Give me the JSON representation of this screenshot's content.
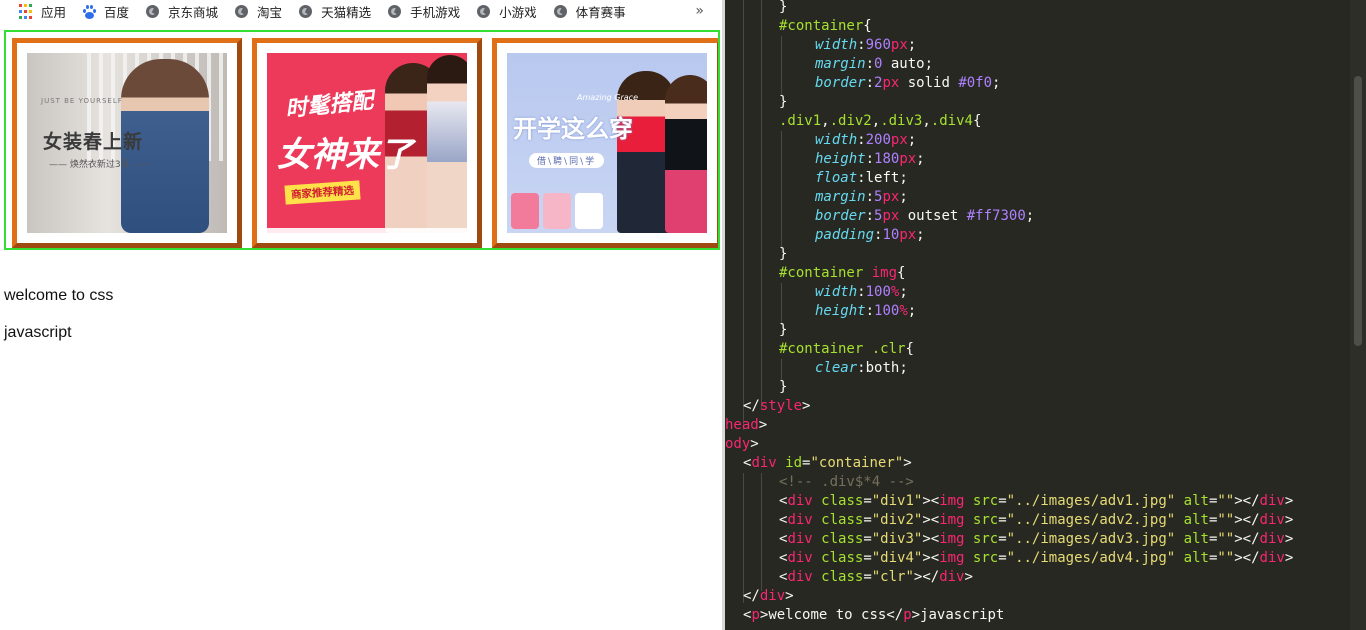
{
  "bookmarks": {
    "items": [
      {
        "label": "应用",
        "icon": "apps-grid-icon"
      },
      {
        "label": "百度",
        "icon": "baidu-paw-icon"
      },
      {
        "label": "京东商城",
        "icon": "globe-icon"
      },
      {
        "label": "淘宝",
        "icon": "globe-icon"
      },
      {
        "label": "天猫精选",
        "icon": "globe-icon"
      },
      {
        "label": "手机游戏",
        "icon": "globe-icon"
      },
      {
        "label": "小游戏",
        "icon": "globe-icon"
      },
      {
        "label": "体育赛事",
        "icon": "globe-icon"
      }
    ],
    "more": "»"
  },
  "ads": [
    {
      "small": "JUST BE YOURSELF",
      "title": "女装春上新",
      "subtitle": "—— 焕然衣新过3月 ——"
    },
    {
      "title1": "时髦搭配",
      "title2": "女神来了",
      "tag": "商家推荐精选"
    },
    {
      "eyebrow": "Amazing Grace",
      "title": "开学这么穿",
      "subtitle": "借\\聘\\同\\学"
    }
  ],
  "page": {
    "p1": "welcome to css",
    "p2": "javascript"
  },
  "colors": {
    "container_border": "#33dd33",
    "ad_border": "#c85e1a",
    "editor_bg": "#272822"
  }
}
